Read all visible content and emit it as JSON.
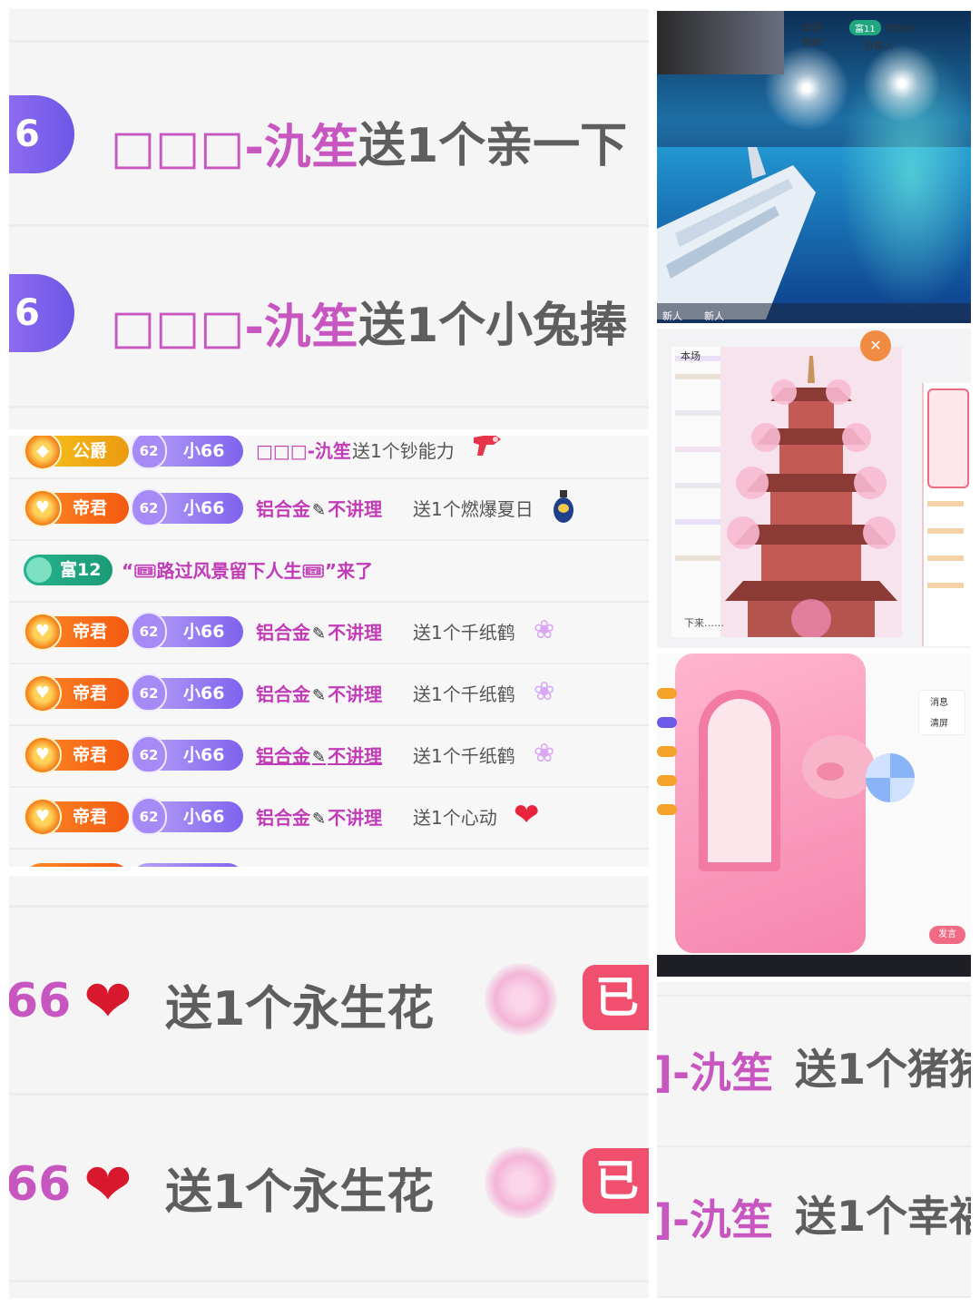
{
  "top_zoom": {
    "rows": [
      {
        "badge": "6",
        "name": "□□□-氿笙",
        "message": "送1个亲一下"
      },
      {
        "badge": "6",
        "name": "□□□-氿笙",
        "message": "送1个小兔捧"
      }
    ]
  },
  "chat": {
    "rows": [
      {
        "rank": "公爵",
        "fan_level": "62",
        "fan_name": "小66",
        "name": "□□□-氿笙",
        "message": "送1个钞能力",
        "gift_icon": "money-gun-icon"
      },
      {
        "rank": "帝君",
        "fan_level": "62",
        "fan_name": "小66",
        "name_a": "铝合金",
        "name_b": "不讲理",
        "message": "送1个燃爆夏日",
        "gift_icon": "bottle-icon"
      },
      {
        "rank_rich": "富12",
        "entry": "“🎟路过风景留下人生🎟”来了"
      },
      {
        "rank": "帝君",
        "fan_level": "62",
        "fan_name": "小66",
        "name_a": "铝合金",
        "name_b": "不讲理",
        "message": "送1个千纸鹤",
        "gift_icon": "paper-crane-icon"
      },
      {
        "rank": "帝君",
        "fan_level": "62",
        "fan_name": "小66",
        "name_a": "铝合金",
        "name_b": "不讲理",
        "message": "送1个千纸鹤",
        "gift_icon": "paper-crane-icon"
      },
      {
        "rank": "帝君",
        "fan_level": "62",
        "fan_name": "小66",
        "name_a": "铝合金",
        "name_b": "不讲理",
        "message": "送1个千纸鹤",
        "gift_icon": "paper-crane-icon"
      },
      {
        "rank": "帝君",
        "fan_level": "62",
        "fan_name": "小66",
        "name_a": "铝合金",
        "name_b": "不讲理",
        "message": "送1个心动",
        "gift_icon": "heart-icon"
      }
    ]
  },
  "bottom_zoom": {
    "rows": [
      {
        "name_tail": "66",
        "message": "送1个永生花",
        "button": "已"
      },
      {
        "name_tail": "66",
        "message": "送1个永生花",
        "button": "已"
      }
    ]
  },
  "right_zoom": {
    "rows": [
      {
        "name": "]-氿笙",
        "message": "送1个猪猪"
      },
      {
        "name": "]-氿笙",
        "message": "送1个幸福"
      }
    ]
  },
  "thumb1": {
    "top_label": "本场榜单",
    "user_badge": "富11",
    "user_name": "李都66",
    "left_label": "新人",
    "left_label2": "新人",
    "viewer_label": "游客人"
  },
  "thumb2": {
    "close_label": "✕",
    "tab_label": "本场",
    "input_label": "下来……"
  },
  "thumb3": {
    "menu_a": "消息",
    "menu_b": "清屏",
    "send_button": "发言"
  }
}
